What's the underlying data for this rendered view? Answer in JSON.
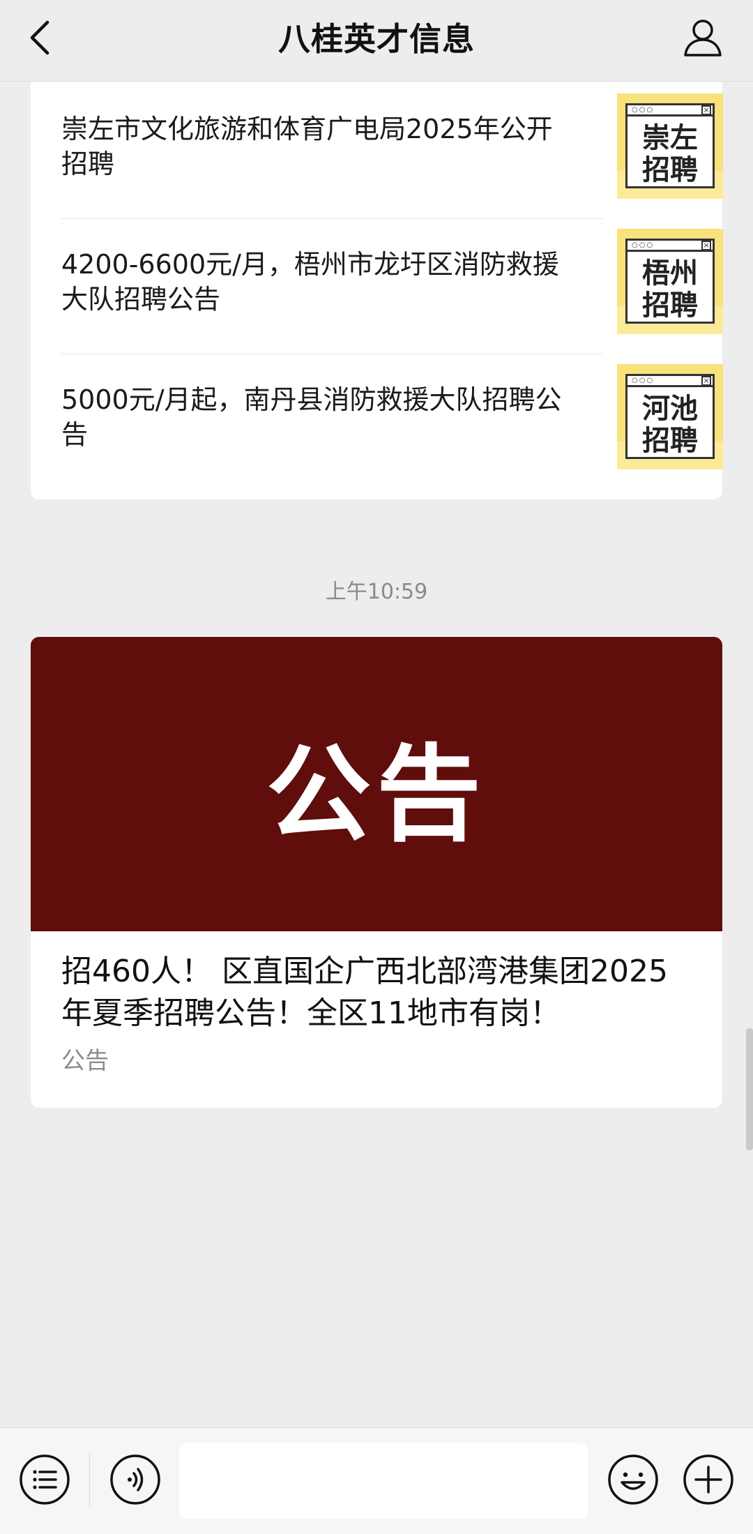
{
  "header": {
    "title": "八桂英才信息",
    "back_icon": "chevron-left-icon",
    "profile_icon": "user-icon"
  },
  "articles": [
    {
      "title": "崇左市文化旅游和体育广电局2025年公开招聘",
      "thumb_label_line1": "崇左",
      "thumb_label_line2": "招聘"
    },
    {
      "title": "4200-6600元/月，梧州市龙圩区消防救援大队招聘公告",
      "thumb_label_line1": "梧州",
      "thumb_label_line2": "招聘"
    },
    {
      "title": "5000元/月起，南丹县消防救援大队招聘公告",
      "thumb_label_line1": "河池",
      "thumb_label_line2": "招聘"
    }
  ],
  "timestamp": "上午10:59",
  "main_article": {
    "cover_text": "公告",
    "cover_color": "#5f0e0c",
    "title": "招460人！ 区直国企广西北部湾港集团2025年夏季招聘公告！全区11地市有岗！",
    "tag": "公告"
  },
  "bottom_bar": {
    "menu_icon": "list-menu-icon",
    "voice_icon": "voice-icon",
    "input_value": "",
    "emoji_icon": "emoji-icon",
    "plus_icon": "plus-icon"
  },
  "thumb_colors": {
    "background": "#f9e27a",
    "frame": "#333333"
  }
}
